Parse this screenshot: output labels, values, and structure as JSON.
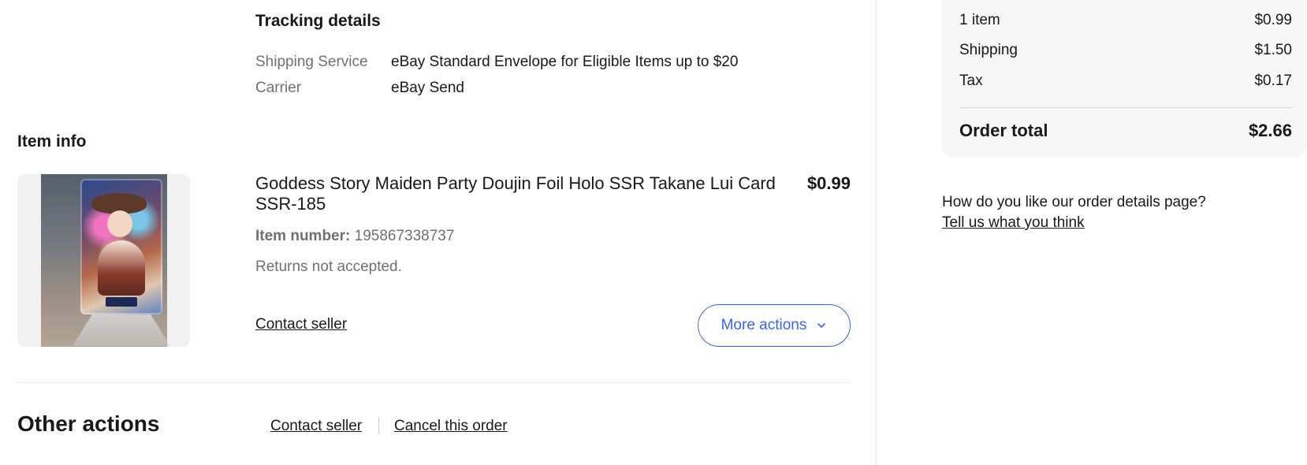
{
  "tracking": {
    "title": "Tracking details",
    "shipping_service_label": "Shipping Service",
    "shipping_service_value": "eBay Standard Envelope for Eligible Items up to $20",
    "carrier_label": "Carrier",
    "carrier_value": "eBay Send"
  },
  "item_info": {
    "title": "Item info",
    "item_title": "Goddess Story Maiden Party Doujin Foil Holo SSR Takane Lui Card SSR-185",
    "price": "$0.99",
    "item_number_label": "Item number:",
    "item_number": "195867338737",
    "returns": "Returns not accepted.",
    "contact_seller": "Contact seller",
    "more_actions": "More actions",
    "image_icon": "trading-card-photo"
  },
  "other_actions": {
    "title": "Other actions",
    "contact_seller": "Contact seller",
    "cancel_order": "Cancel this order"
  },
  "summary": {
    "items_label": "1 item",
    "items_value": "$0.99",
    "shipping_label": "Shipping",
    "shipping_value": "$1.50",
    "tax_label": "Tax",
    "tax_value": "$0.17",
    "total_label": "Order total",
    "total_value": "$2.66"
  },
  "feedback": {
    "question": "How do you like our order details page?",
    "link": "Tell us what you think"
  },
  "colors": {
    "accent_blue": "#3665f3",
    "muted_text": "#707070",
    "summary_bg": "#f7f7f7"
  }
}
